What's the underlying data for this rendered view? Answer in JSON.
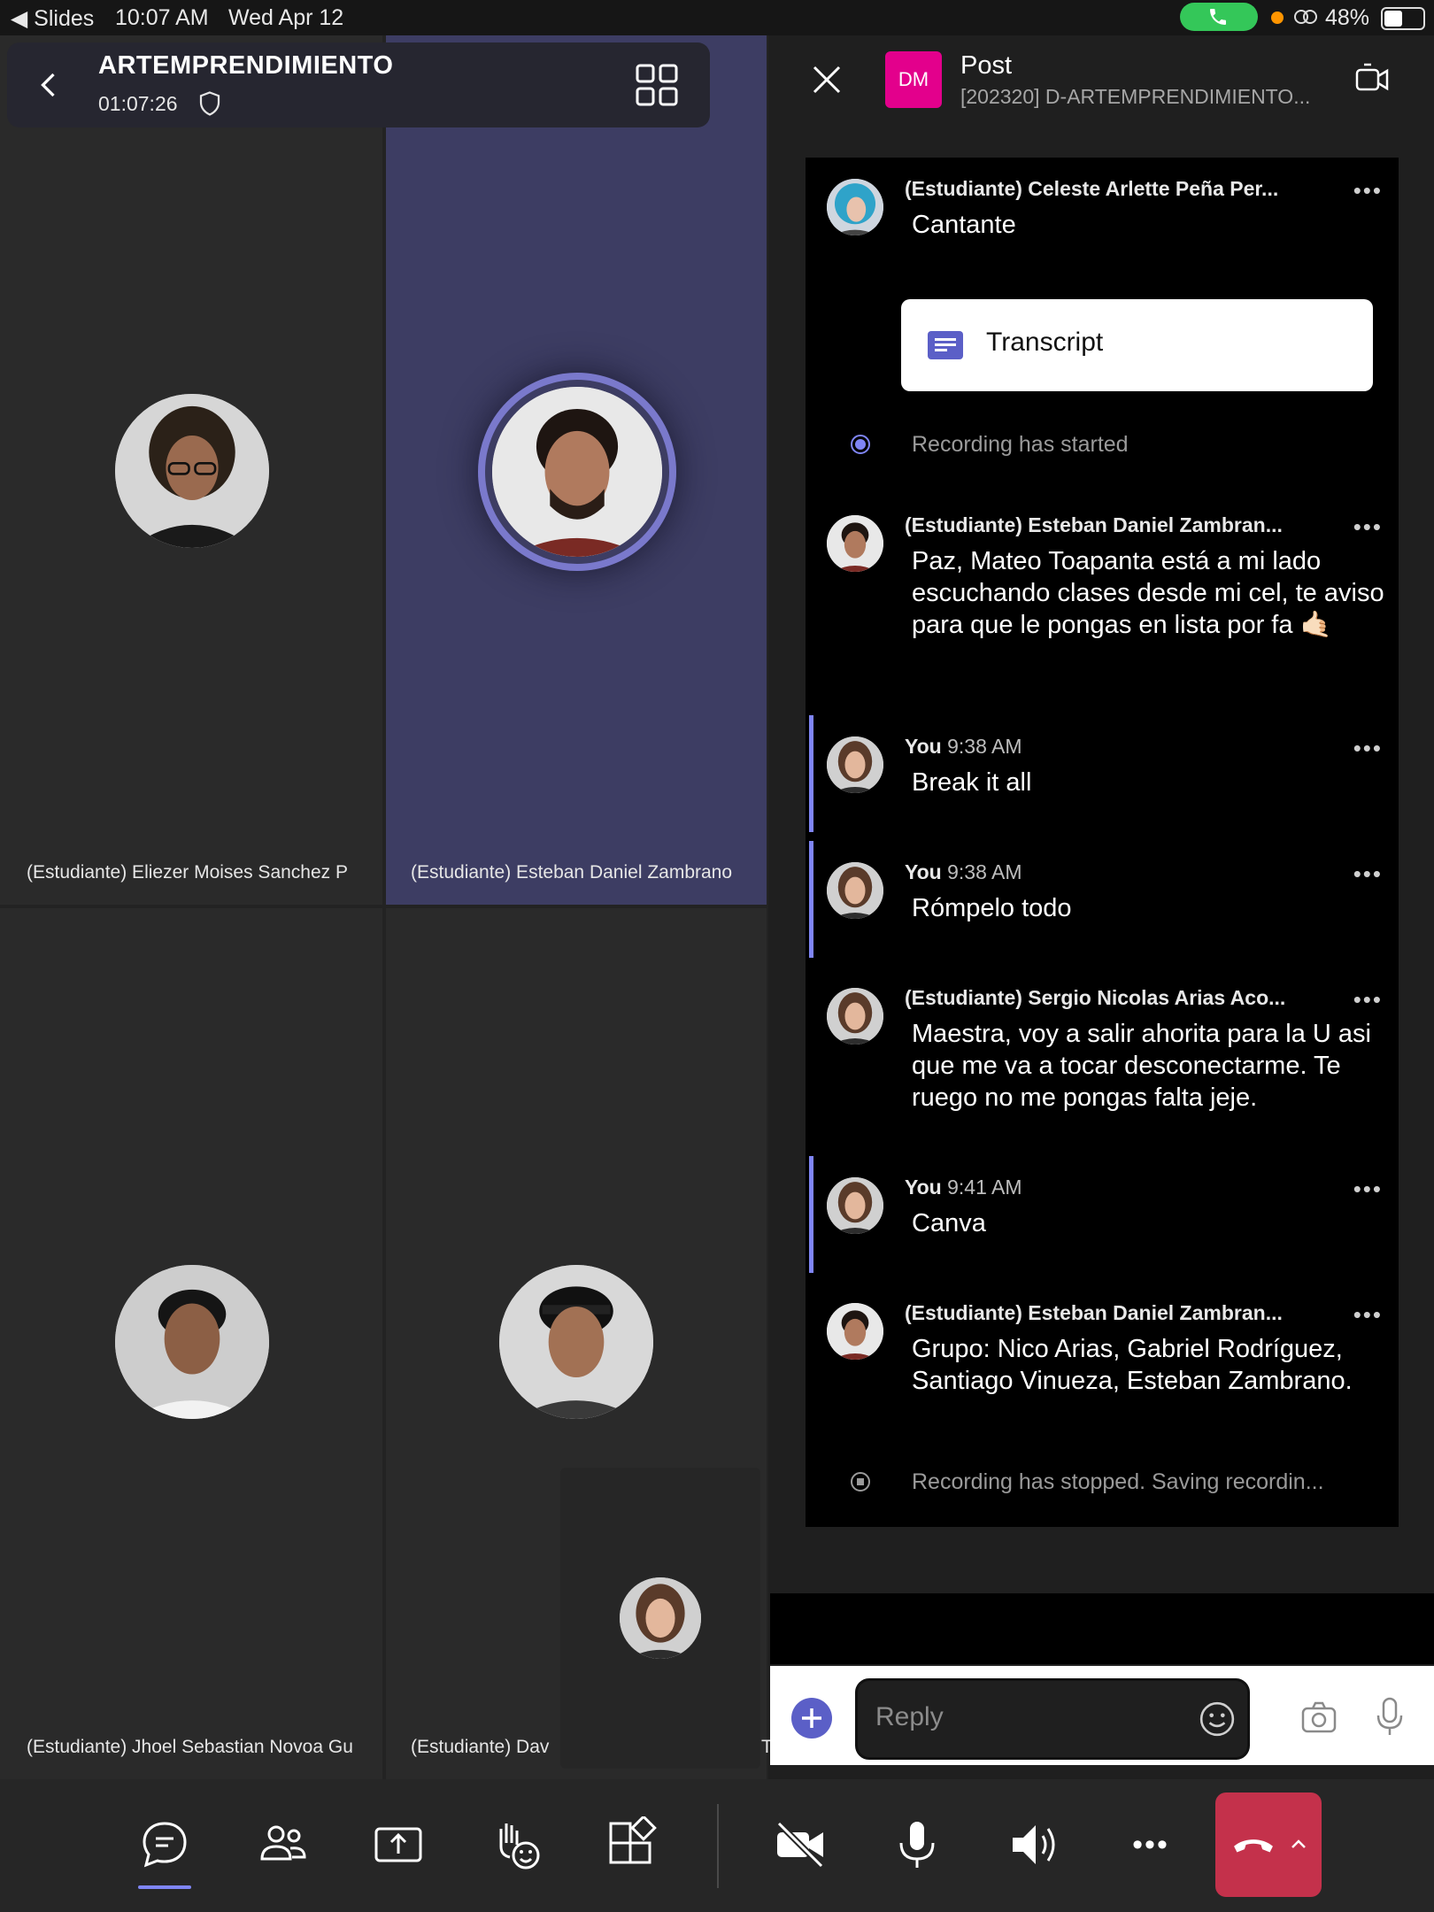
{
  "status_bar": {
    "back_app": "◀ Slides",
    "time": "10:07 AM",
    "date": "Wed Apr 12",
    "battery": "48%",
    "battery_level": 0.48
  },
  "meeting": {
    "title": "ARTEMPRENDIMIENTO",
    "timer": "01:07:26"
  },
  "participants": [
    {
      "name": "(Estudiante) Eliezer Moises Sanchez P"
    },
    {
      "name": "(Estudiante) Esteban Daniel Zambrano"
    },
    {
      "name": "(Estudiante) Jhoel Sebastian Novoa Gu"
    },
    {
      "name": "(Estudiante) Dav"
    },
    {
      "name": "T"
    }
  ],
  "chat": {
    "header": {
      "badge": "DM",
      "title": "Post",
      "subtitle": "[202320] D-ARTEMPRENDIMIENTO..."
    },
    "messages": [
      {
        "author": "(Estudiante) Celeste Arlette Peña Per...",
        "time": "",
        "text": "Cantante"
      },
      {
        "author": "(Estudiante) Esteban Daniel Zambran...",
        "time": "",
        "text": "Paz, Mateo Toapanta está a mi lado escuchando clases desde mi cel, te aviso para que le pongas en lista por fa 🤙🏻"
      },
      {
        "author": "You",
        "time": "9:38 AM",
        "text": "Break it all"
      },
      {
        "author": "You",
        "time": "9:38 AM",
        "text": "Rómpelo todo"
      },
      {
        "author": "(Estudiante) Sergio Nicolas Arias Aco...",
        "time": "",
        "text": "Maestra, voy a salir ahorita para la U asi que me va a tocar desconectarme. Te ruego no me pongas falta jeje."
      },
      {
        "author": "You",
        "time": "9:41 AM",
        "text": "Canva"
      },
      {
        "author": "(Estudiante) Esteban Daniel Zambran...",
        "time": "",
        "text": "Grupo: Nico Arias, Gabriel Rodríguez, Santiago Vinueza, Esteban Zambrano."
      }
    ],
    "transcript_label": "Transcript",
    "recording_started": "Recording has started",
    "recording_stopped": "Recording has stopped. Saving recordin...",
    "reply_placeholder": "Reply",
    "more_glyph": "•••"
  },
  "toolbar": {
    "more_glyph": "•••",
    "chevron_glyph": "^"
  },
  "colors": {
    "accent": "#7f85f5",
    "brand": "#5b5fc7",
    "dm_badge": "#e3008c",
    "hangup": "#c4314b",
    "call_pill": "#34c759"
  },
  "icons": [
    "chevron-left-icon",
    "grid-layout-icon",
    "shield-icon",
    "close-icon",
    "video-call-icon",
    "chat-icon",
    "people-icon",
    "share-icon",
    "raise-hand-icon",
    "apps-icon",
    "camera-off-icon",
    "microphone-icon",
    "speaker-icon",
    "more-icon",
    "hang-up-icon",
    "chevron-up-icon",
    "plus-icon",
    "emoji-icon",
    "camera-icon"
  ]
}
